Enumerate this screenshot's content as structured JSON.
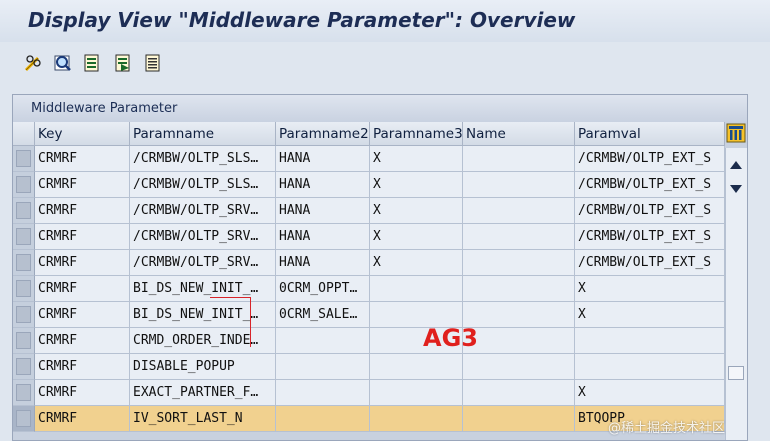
{
  "window": {
    "title": "Display View \"Middleware Parameter\": Overview"
  },
  "toolbar": {
    "buttons": [
      {
        "icon": "edit-glasses-icon",
        "tooltip": ""
      },
      {
        "icon": "find-icon",
        "tooltip": ""
      },
      {
        "icon": "document-icon",
        "tooltip": ""
      },
      {
        "icon": "document-export-icon",
        "tooltip": ""
      },
      {
        "icon": "document-list-icon",
        "tooltip": ""
      }
    ]
  },
  "table": {
    "title": "Middleware Parameter",
    "columns": [
      "Key",
      "Paramname",
      "Paramname2",
      "Paramname3",
      "Name",
      "Paramval"
    ],
    "rows": [
      [
        "CRMRF",
        "/CRMBW/OLTP_SLS…",
        "HANA",
        "X",
        "",
        "/CRMBW/OLTP_EXT_S"
      ],
      [
        "CRMRF",
        "/CRMBW/OLTP_SLS…",
        "HANA",
        "X",
        "",
        "/CRMBW/OLTP_EXT_S"
      ],
      [
        "CRMRF",
        "/CRMBW/OLTP_SRV…",
        "HANA",
        "X",
        "",
        "/CRMBW/OLTP_EXT_S"
      ],
      [
        "CRMRF",
        "/CRMBW/OLTP_SRV…",
        "HANA",
        "X",
        "",
        "/CRMBW/OLTP_EXT_S"
      ],
      [
        "CRMRF",
        "/CRMBW/OLTP_SRV…",
        "HANA",
        "X",
        "",
        "/CRMBW/OLTP_EXT_S"
      ],
      [
        "CRMRF",
        "BI_DS_NEW_INIT_…",
        "0CRM_OPPT…",
        "",
        "",
        "X"
      ],
      [
        "CRMRF",
        "BI_DS_NEW_INIT_…",
        "0CRM_SALE…",
        "",
        "",
        "X"
      ],
      [
        "CRMRF",
        "CRMD_ORDER_INDE…",
        "",
        "",
        "",
        ""
      ],
      [
        "CRMRF",
        "DISABLE_POPUP",
        "",
        "",
        "",
        ""
      ],
      [
        "CRMRF",
        "EXACT_PARTNER_F…",
        "",
        "",
        "",
        "X"
      ],
      [
        "CRMRF",
        "IV_SORT_LAST_N",
        "",
        "",
        "",
        "BTQOPP"
      ]
    ],
    "selected_row": 10
  },
  "annotation": {
    "text": "AG3",
    "color": "#e0201d"
  },
  "watermark": {
    "text": "@稀土掘金技术社区"
  },
  "colors": {
    "selected_row": "#f1d18f",
    "title_text": "#1d2d55"
  }
}
